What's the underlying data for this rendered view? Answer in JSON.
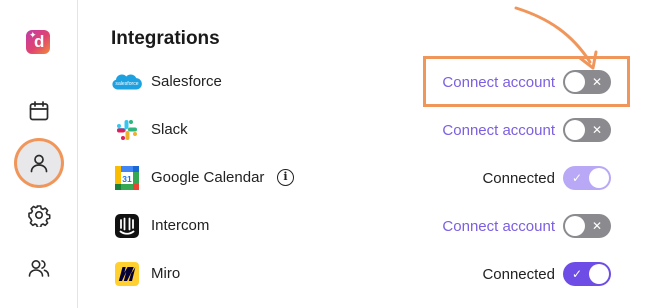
{
  "sidebar": {
    "logo_letter": "d",
    "items": [
      {
        "icon": "calendar-icon"
      },
      {
        "icon": "person-icon",
        "active": true
      },
      {
        "icon": "gear-icon"
      },
      {
        "icon": "users-icon"
      }
    ]
  },
  "page": {
    "title": "Integrations"
  },
  "integrations": [
    {
      "name": "Salesforce",
      "action": "Connect account",
      "toggle": "off"
    },
    {
      "name": "Slack",
      "action": "Connect account",
      "toggle": "off"
    },
    {
      "name": "Google Calendar",
      "status": "Connected",
      "toggle": "on-disabled",
      "calendar_day": "31"
    },
    {
      "name": "Intercom",
      "action": "Connect account",
      "toggle": "off"
    },
    {
      "name": "Miro",
      "status": "Connected",
      "toggle": "on"
    }
  ],
  "salesforce_logo_text": "salesforce",
  "info_glyph": "i",
  "toggle_marks": {
    "off": "✕",
    "on": "✓"
  },
  "colors": {
    "accent": "#6d4de6",
    "link": "#7c5fe0",
    "highlight": "#f0965a",
    "toggle_off": "#8a8a8f",
    "toggle_on_faded": "#b9a8f5"
  }
}
